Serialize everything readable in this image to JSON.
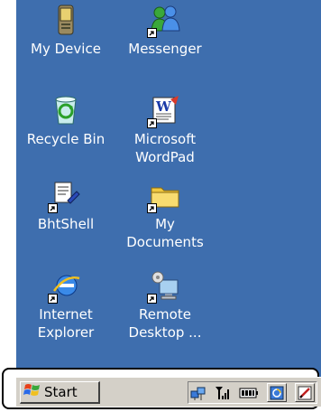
{
  "desktop": {
    "icons": [
      {
        "label": "My Device",
        "icon": "my-device-icon"
      },
      {
        "label": "Messenger",
        "icon": "messenger-icon"
      },
      {
        "label": "Recycle Bin",
        "icon": "recycle-bin-icon"
      },
      {
        "label_line1": "Microsoft",
        "label_line2": "WordPad",
        "icon": "wordpad-icon"
      },
      {
        "label": "BhtShell",
        "icon": "bhtshell-icon"
      },
      {
        "label_line1": "My",
        "label_line2": "Documents",
        "icon": "documents-folder-icon"
      },
      {
        "label_line1": "Internet",
        "label_line2": "Explorer",
        "icon": "internet-explorer-icon"
      },
      {
        "label_line1": "Remote",
        "label_line2": "Desktop ...",
        "icon": "remote-desktop-icon"
      }
    ],
    "background_color": "#3e6eae"
  },
  "taskbar": {
    "start_label": "Start",
    "tray_icons": [
      "network-icon",
      "signal-strength-icon",
      "battery-icon",
      "desktop-toggle-icon",
      "input-panel-icon"
    ]
  }
}
